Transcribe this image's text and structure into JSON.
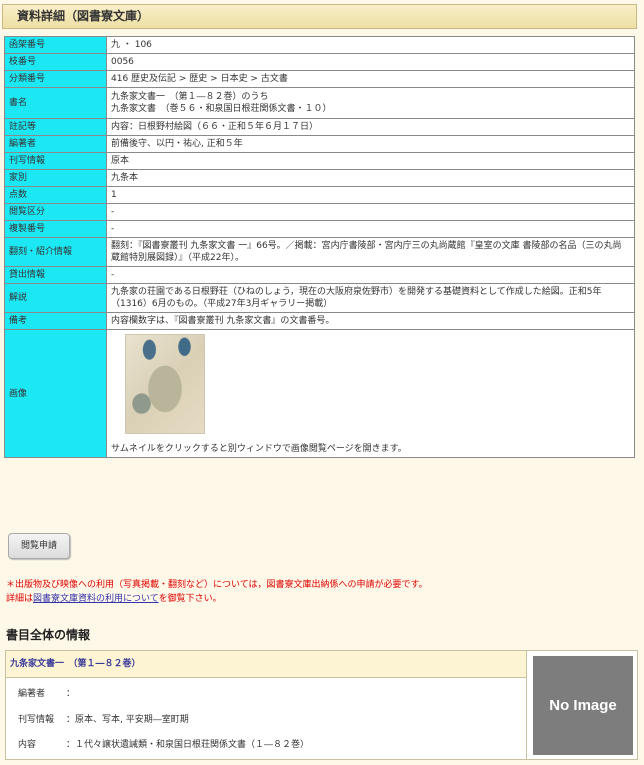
{
  "page_title": "資料詳細（図書寮文庫）",
  "detail_rows": [
    {
      "label": "函架番号",
      "value": "九 ・ 106"
    },
    {
      "label": "枝番号",
      "value": "0056"
    },
    {
      "label": "分類番号",
      "value": "416 歴史及伝記 > 歴史 > 日本史 > 古文書"
    },
    {
      "label": "書名",
      "value_line1": "九条家文書一　（第１―８２巻）のうち",
      "value_line2": "九条家文書　（巻５６・和泉国日根荘関係文書・１０）"
    },
    {
      "label": "註記等",
      "value": "内容：日根野村絵図（６６・正和５年６月１７日）"
    },
    {
      "label": "編著者",
      "value": "前備後守、以円・祐心, 正和５年"
    },
    {
      "label": "刊写情報",
      "value": "原本"
    },
    {
      "label": "家別",
      "value": "九条本"
    },
    {
      "label": "点数",
      "value": "1"
    },
    {
      "label": "閲覧区分",
      "value": "-"
    },
    {
      "label": "複製番号",
      "value": "-"
    },
    {
      "label": "翻刻・紹介情報",
      "value": "翻刻：『図書寮叢刊 九条家文書 一』66号。／掲載：宮内庁書陵部・宮内庁三の丸尚蔵館『皇室の文庫 書陵部の名品（三の丸尚蔵館特別展図録）』（平成22年）。"
    },
    {
      "label": "貸出情報",
      "value": "-"
    },
    {
      "label": "解説",
      "value": "九条家の荘園である日根野荘（ひねのしょう，現在の大阪府泉佐野市）を開発する基礎資料として作成した絵図。正和5年（1316）6月のもの。（平成27年3月ギャラリー掲載）"
    },
    {
      "label": "備考",
      "value": "内容欄数字は、『図書寮叢刊 九条家文書』の文書番号。"
    },
    {
      "label": "画像",
      "thumbnail_alt": "日根野村絵図",
      "thumbnail_note": "サムネイルをクリックすると別ウィンドウで画像閲覧ページを開きます。"
    }
  ],
  "request_button": "閲覧申請",
  "notice": {
    "line1": "＊出版物及び映像への利用（写真掲載・翻刻など）については，図書寮文庫出納係への申請が必要です。",
    "line2_prefix": "詳細は",
    "line2_link": "図書寮文庫資料の利用について",
    "line2_suffix": "を御覧下さい。"
  },
  "biblio_section": {
    "heading": "書目全体の情報",
    "title": "九条家文書一　（第１―８２巻）",
    "rows": [
      {
        "key": "編著者",
        "sep": "：",
        "value": ""
      },
      {
        "key": "刊写情報",
        "sep": "：",
        "value": "原本、写本, 平安期―室町期"
      },
      {
        "key": "内容",
        "sep": "：",
        "value": "１代々譲状遺誡類・和泉国日根荘関係文書（１―８２巻）"
      }
    ],
    "no_image": "No Image"
  },
  "colors": {
    "label_bg": "#1ce8f4",
    "page_bg": "#fdf8e8",
    "notice": "#e00000",
    "link": "#3333aa"
  }
}
